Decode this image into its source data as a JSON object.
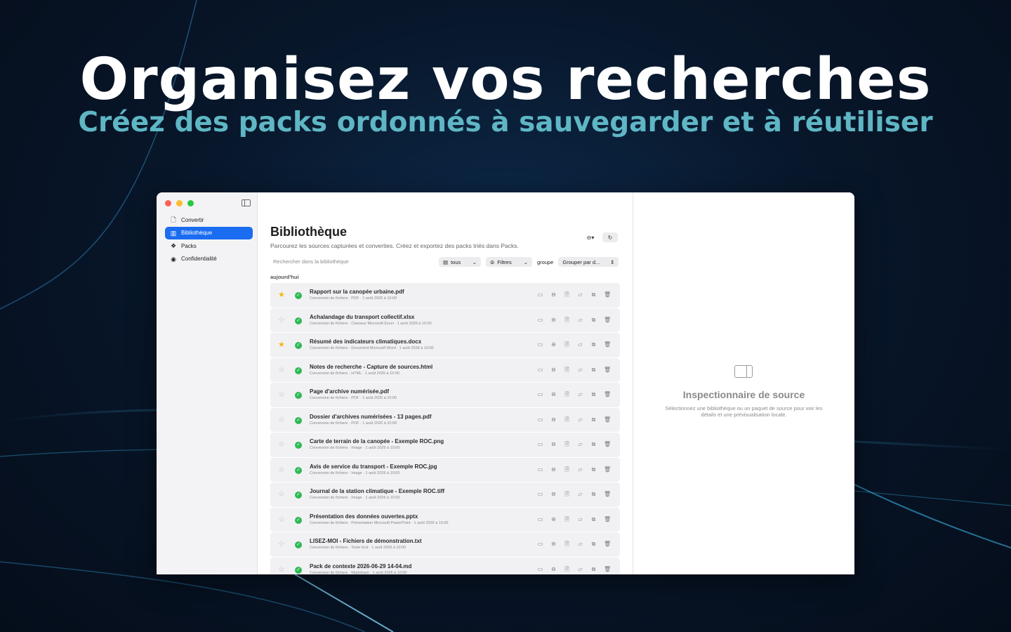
{
  "headline": "Organisez vos recherches",
  "subline": "Créez des packs ordonnés à sauvegarder et à réutiliser",
  "sidebar": {
    "items": [
      {
        "label": "Convertir",
        "icon": "document-icon",
        "glyph": "🗋",
        "active": false
      },
      {
        "label": "Bibliothèque",
        "icon": "library-icon",
        "glyph": "▥",
        "active": true
      },
      {
        "label": "Packs",
        "icon": "packs-icon",
        "glyph": "❖",
        "active": false
      },
      {
        "label": "Confidentialité",
        "icon": "privacy-icon",
        "glyph": "◉",
        "active": false
      }
    ]
  },
  "main": {
    "title": "Bibliothèque",
    "subtitle": "Parcourez les sources capturées et converties. Créez et exportez des packs triés dans Packs.",
    "search_placeholder": "Rechercher dans la bibliothèque",
    "filter_type": "tous",
    "filters_label": "Filtres",
    "group_label": "groupe",
    "group_select": "Grouper par d...",
    "section_label": "aujourd'hui",
    "rows": [
      {
        "name": "Rapport sur la canopée urbaine.pdf",
        "meta": "Conversion de fichiers · PDF · 1 août 2026 à 10:00",
        "starred": true
      },
      {
        "name": "Achalandage du transport collectif.xlsx",
        "meta": "Conversion de fichiers · Classeur Microsoft Excel · 1 août 2026 à 10:00",
        "starred": false
      },
      {
        "name": "Résumé des indicateurs climatiques.docx",
        "meta": "Conversion de fichiers · Document Microsoft Word · 1 août 2026 à 10:00",
        "starred": true
      },
      {
        "name": "Notes de recherche - Capture de sources.html",
        "meta": "Conversion de fichiers · HTML · 1 août 2026 à 10:00",
        "starred": false
      },
      {
        "name": "Page d'archive numérisée.pdf",
        "meta": "Conversion de fichiers · PDF · 1 août 2026 à 10:00",
        "starred": false
      },
      {
        "name": "Dossier d'archives numérisées - 13 pages.pdf",
        "meta": "Conversion de fichiers · PDF · 1 août 2026 à 10:00",
        "starred": false
      },
      {
        "name": "Carte de terrain de la canopée - Exemple ROC.png",
        "meta": "Conversion de fichiers · Image · 1 août 2026 à 10:00",
        "starred": false
      },
      {
        "name": "Avis de service du transport - Exemple ROC.jpg",
        "meta": "Conversion de fichiers · Image · 1 août 2026 à 10:00",
        "starred": false
      },
      {
        "name": "Journal de la station climatique - Exemple ROC.tiff",
        "meta": "Conversion de fichiers · Image · 1 août 2026 à 10:00",
        "starred": false
      },
      {
        "name": "Présentation des données ouvertes.pptx",
        "meta": "Conversion de fichiers · Présentation Microsoft PowerPoint · 1 août 2026 à 10:00",
        "starred": false
      },
      {
        "name": "LISEZ-MOI - Fichiers de démonstration.txt",
        "meta": "Conversion de fichiers · Texte brut · 1 août 2026 à 10:00",
        "starred": false
      },
      {
        "name": "Pack de contexte 2026-06-29 14-04.md",
        "meta": "Conversion de fichiers · Markdown · 1 août 2026 à 10:00",
        "starred": false
      }
    ]
  },
  "inspector": {
    "title": "Inspectionnaire de source",
    "description": "Sélectionnez une bibliothèque ou un paquet de source pour voir les détails et une prévisualisation locale."
  },
  "colors": {
    "accent": "#1a6cf0",
    "subline": "#5fb6c4",
    "star_on": "#f3b50f",
    "check": "#2fb955"
  }
}
